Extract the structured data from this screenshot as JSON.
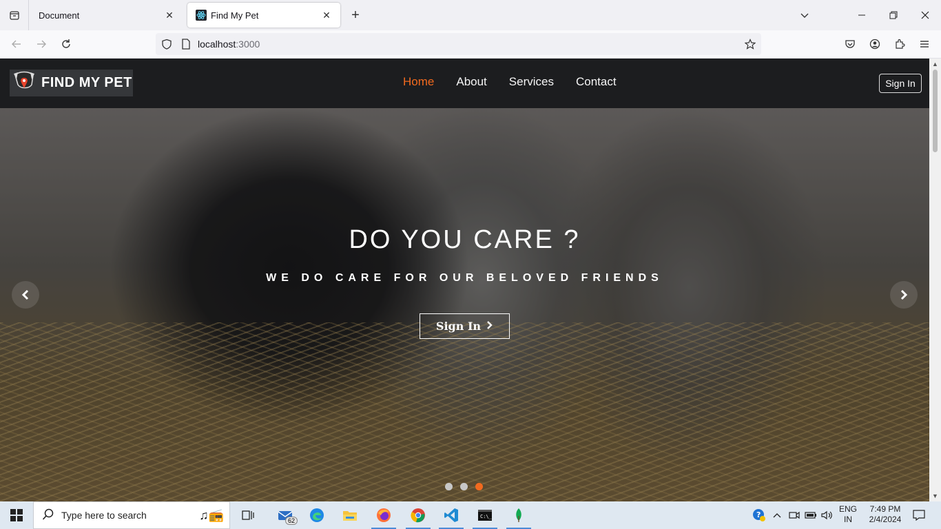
{
  "browser": {
    "tabs": [
      {
        "title": "Document",
        "active": false
      },
      {
        "title": "Find My Pet",
        "active": true
      }
    ],
    "url_host": "localhost",
    "url_port": ":3000"
  },
  "site": {
    "logo_text": "FIND MY PET",
    "menu": [
      "Home",
      "About",
      "Services",
      "Contact"
    ],
    "active_menu": "Home",
    "header_signin": "Sign In",
    "accent_color": "#f26a1f"
  },
  "hero": {
    "title": "DO YOU CARE ?",
    "subtitle": "WE DO CARE FOR OUR BELOVED FRIENDS",
    "button_label": "Sign In",
    "slide_count": 3,
    "active_slide": 3
  },
  "taskbar": {
    "search_placeholder": "Type here to search",
    "mail_badge": "62",
    "language_line1": "ENG",
    "language_line2": "IN",
    "time": "7:49 PM",
    "date": "2/4/2024"
  }
}
